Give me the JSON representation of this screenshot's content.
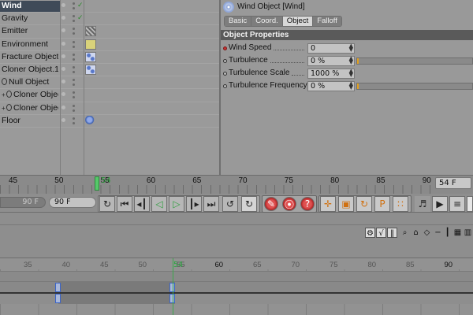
{
  "object_manager": {
    "objects": [
      {
        "name": "Wind",
        "selected": true,
        "tag": ""
      },
      {
        "name": "Gravity",
        "tag": ""
      },
      {
        "name": "Emitter",
        "tag": "stripe"
      },
      {
        "name": "Environment",
        "tag": "pencil"
      },
      {
        "name": "Fracture Object",
        "tag": "grid"
      },
      {
        "name": "Cloner Object.1",
        "tag": "grid"
      },
      {
        "name": "Null Object",
        "tag": ""
      },
      {
        "name": "Cloner Object",
        "tag": ""
      },
      {
        "name": "Cloner Object",
        "tag": ""
      },
      {
        "name": "Floor",
        "tag": "ball"
      }
    ]
  },
  "attribute_manager": {
    "title": "Wind Object [Wind]",
    "tabs": [
      "Basic",
      "Coord.",
      "Object",
      "Falloff"
    ],
    "active_tab": "Object",
    "section": "Object Properties",
    "properties": [
      {
        "label": "Wind Speed",
        "value": "0",
        "keyed": true
      },
      {
        "label": "Turbulence",
        "value": "0 %",
        "bar_fraction": 0.01
      },
      {
        "label": "Turbulence Scale",
        "value": "1000 %"
      },
      {
        "label": "Turbulence Frequency",
        "value": "0 %",
        "bar_fraction": 0.01
      }
    ]
  },
  "timeline": {
    "ruler_labels": [
      "45",
      "50",
      "55",
      "60",
      "65",
      "70",
      "75",
      "80",
      "85",
      "90"
    ],
    "current_frame": "54",
    "current_frame_field": "54 F",
    "start_field": "90 F",
    "end_field": "90 F",
    "dope_labels": [
      "35",
      "40",
      "45",
      "50",
      "55",
      "60",
      "65",
      "70",
      "75",
      "80",
      "85",
      "90"
    ],
    "dope_current": "54"
  },
  "icons": {
    "transport": [
      "loop-back-icon",
      "goto-start-icon",
      "prev-key-icon",
      "play-backward-icon",
      "play-forward-icon",
      "next-key-icon",
      "goto-end-icon",
      "loop-icon",
      "loop-active-icon"
    ],
    "record": [
      "record-icon",
      "auto-key-icon",
      "help-key-icon"
    ],
    "key_modes": [
      "move-key-icon",
      "scale-key-icon",
      "rotate-key-icon",
      "param-key-icon",
      "point-key-icon"
    ]
  },
  "colors": {
    "selection": "#3f4a58",
    "playhead": "#56c86a",
    "key": "#3a64c8",
    "accent_bar": "#e0a020"
  }
}
